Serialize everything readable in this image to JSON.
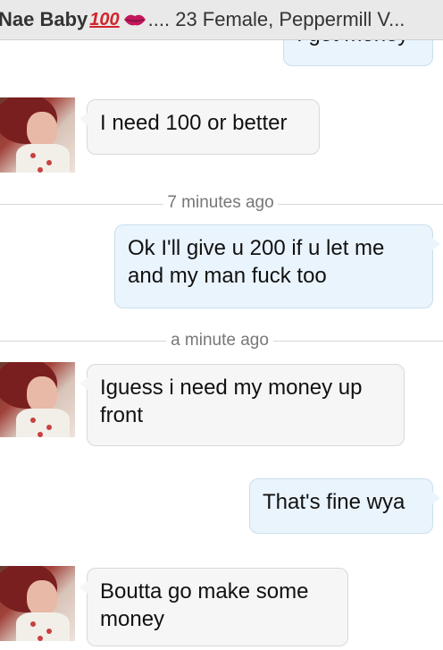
{
  "header": {
    "name": "Nae Baby",
    "hundred_emoji": "100",
    "details": ".... 23 Female, Peppermill V..."
  },
  "messages": [
    {
      "direction": "outgoing",
      "text": "I got money"
    },
    {
      "direction": "incoming",
      "text": "I need 100 or better"
    },
    {
      "direction": "outgoing",
      "text": "Ok I'll give u 200 if u let me and my man fuck too"
    },
    {
      "direction": "incoming",
      "text": "Iguess i need my money up front"
    },
    {
      "direction": "outgoing",
      "text": "That's fine wya"
    },
    {
      "direction": "incoming",
      "text": "Boutta go make some money"
    }
  ],
  "timestamps": [
    "7 minutes ago",
    "a minute ago"
  ],
  "colors": {
    "incoming_bubble": "#f6f6f6",
    "outgoing_bubble": "#eaf4fd",
    "hundred_emoji": "#d0252b",
    "lips": "#c2185b"
  },
  "icons": [
    "hundred-points-emoji",
    "kiss-mark-emoji",
    "contact-avatar"
  ]
}
